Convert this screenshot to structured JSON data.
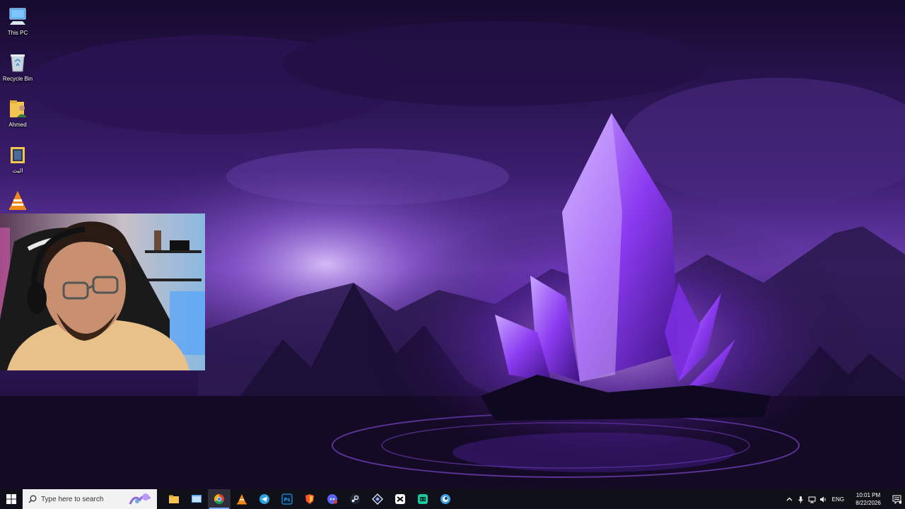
{
  "desktop": {
    "icons": [
      {
        "label": "This PC",
        "icon": "this-pc-icon"
      },
      {
        "label": "Recycle Bin",
        "icon": "recycle-bin-icon"
      },
      {
        "label": "Ahmed",
        "icon": "user-folder-icon"
      },
      {
        "label": "البث",
        "icon": "folder-icon"
      },
      {
        "label": "",
        "icon": "vlc-icon"
      }
    ]
  },
  "taskbar": {
    "search_placeholder": "Type here to search",
    "apps": [
      {
        "name": "file-explorer",
        "icon": "folder-icon",
        "active": false
      },
      {
        "name": "desktop-window",
        "icon": "window-icon",
        "active": false
      },
      {
        "name": "chrome",
        "icon": "chrome-icon",
        "active": true
      },
      {
        "name": "vlc",
        "icon": "vlc-icon",
        "active": false
      },
      {
        "name": "telegram",
        "icon": "telegram-icon",
        "active": false
      },
      {
        "name": "photoshop",
        "icon": "photoshop-icon",
        "active": false
      },
      {
        "name": "brave",
        "icon": "shield-icon",
        "active": false
      },
      {
        "name": "discord",
        "icon": "discord-icon",
        "active": false
      },
      {
        "name": "steam",
        "icon": "steam-icon",
        "active": false
      },
      {
        "name": "dev-tool",
        "icon": "diamond-icon",
        "active": false
      },
      {
        "name": "capcut",
        "icon": "capcut-icon",
        "active": false
      },
      {
        "name": "game-app",
        "icon": "gamepad-icon",
        "active": false
      },
      {
        "name": "app",
        "icon": "circle-app-icon",
        "active": false
      }
    ],
    "tray": {
      "language": "ENG",
      "time": "10:01 PM",
      "date": "8/22/2026"
    }
  },
  "colors": {
    "accent": "#7aa7ff",
    "taskbar": "#101018",
    "crystal": "#9b4dff"
  }
}
